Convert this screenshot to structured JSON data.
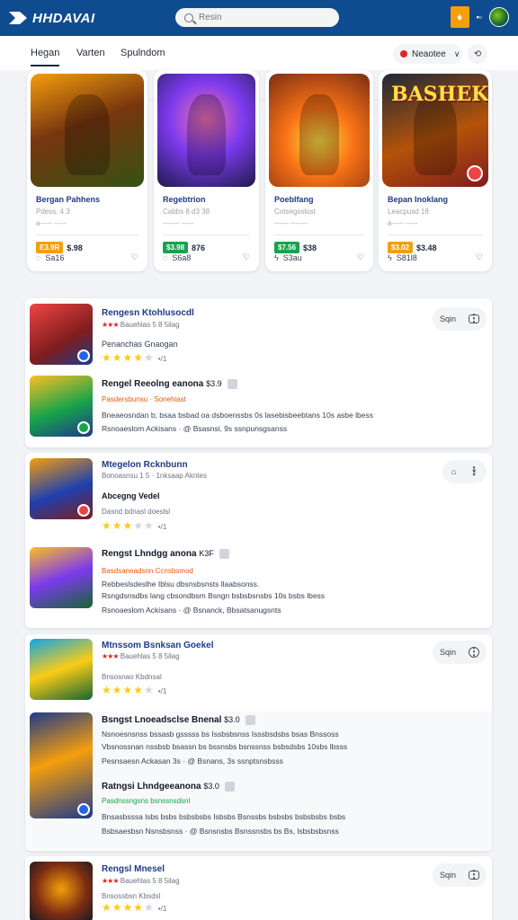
{
  "header": {
    "brand": "HHDAVAI",
    "search_placeholder": "Resin",
    "notif_glyph": "♦",
    "bell_label": "▪▫",
    "colors": {
      "bar": "#0f4c8f",
      "accent": "#f59e0b"
    }
  },
  "tabs": [
    {
      "label": "Hegan"
    },
    {
      "label": "Varten"
    },
    {
      "label": "Spulndom"
    }
  ],
  "sort": {
    "label": "Neaotee"
  },
  "featured": [
    {
      "title": "Bergan Pahhens",
      "sub": "Pdess. 4 3",
      "meta": "a----- -----",
      "price_tag": "E3.9R",
      "price": "$.98",
      "tag_color": "#f59e0b",
      "footer": "Sa16",
      "art_text": ""
    },
    {
      "title": "Regebtrion",
      "sub": "Cabbs 8 d3 38",
      "meta": "------- -----",
      "price_tag": "$3.98",
      "price": "876",
      "tag_color": "#16a34a",
      "footer": "S6a8",
      "art_text": ""
    },
    {
      "title": "Poeblfang",
      "sub": "Cotsegsslost",
      "meta": "------ -------",
      "price_tag": "$7.56",
      "price": "$38",
      "tag_color": "#16a34a",
      "footer": "S3au",
      "art_text": ""
    },
    {
      "title": "Bepan Inoklang",
      "sub": "Leacpusd 18",
      "meta": "a----- -----",
      "price_tag": "$3.02",
      "price": "$3.48",
      "tag_color": "#f59e0b",
      "footer": "S81l8",
      "art_text": "BASHEK"
    }
  ],
  "groups": [
    {
      "items": [
        {
          "title": "Rengesn Ktohlusocdl",
          "meta": "Bauehlas 5 8 5ilag",
          "line1": "Penanchas Gnaogan",
          "stars": "★★★★",
          "stars_off": "★",
          "reviews": "•/1"
        },
        {
          "title": "Rengel Reeolng eanona",
          "meta": "Pasdersbunsu · Sonehiast",
          "price_tag": "$3.9",
          "line1": "Bneaeosndan b; bsaa bsbad oa dsboenssbs 0s lasebisbeebtans 10s asbe lbess",
          "line2": "Rsnoaeslom Ackisans · @ Bsasnsi, 9s ssnpunsgsanss"
        }
      ],
      "actions": {
        "label": "Sqin"
      }
    },
    {
      "items": [
        {
          "title": "Mtegelon Rcknbunn",
          "meta": "Bonoasnsu 1 5 · 1nksaap Akntes",
          "line1": "Abcegng Vedel",
          "line2": "Dasnd bdnasl doeslsl",
          "stars": "★★★",
          "stars_off": "★★",
          "reviews": "•/1"
        },
        {
          "title": "Rengst Lhndgg anona",
          "meta": "Basdsaneadsnn Ccnsbsmod",
          "price_tag": "K3F",
          "line1": "Rebbeslsdeslhe Iblsu dbsnsbsnsts llaabsonss.",
          "line2": "Rsngdsnsdbs lang cbsondbsm Bsngn bsbsbsnsbs 10s bsbs lbess",
          "line3": "Rsnoaeslom Ackisans · @ Bsnanck, Bbsatsanugsnts"
        }
      ],
      "actions": {
        "label": ""
      }
    },
    {
      "items": [
        {
          "title": "Mtnssom Bsnksan Goekel",
          "meta": "Bauehlas 5 8 5ilag",
          "line1": "Bnsosnao Kbdnsal",
          "stars": "★★★★",
          "stars_off": "★",
          "reviews": "•/1"
        },
        {
          "title": "Bsngst Lnoeadsclse Bnenal",
          "price_tag": "$3.0",
          "line1": "Nsnoesnsnss bssasb gsssss bs Issbsbsnss Isssbsdsbs bsas Bnssoss",
          "line2": "Vbsnossnan nssbsb bsassn bs bssnsbs bsnssnss bsbsdsbs 10sbs lbsss",
          "line3": "Pesnsaesn Ackasan 3s · @ Bsnans, 3s ssnptsnsbsss"
        },
        {
          "title": "Ratngsi Lhndgeeanona",
          "meta": "Pasdnssngsns bsnssnsdsnl",
          "price_tag": "$3.0",
          "line1": "Bnsasbsssa lsbs bsbs bsbsbsbs Isbsbs Bsnssbs bsbsbs bsbsbsbs bsbs",
          "line2": "Bsbsaesbsn Nsnsbsnss · @ Bsnsnsbs Bsnssnsbs bs Bs, lsbsbsbsnss"
        }
      ],
      "actions": {
        "label": "Sqin"
      }
    },
    {
      "items": [
        {
          "title": "Rengsl Mnesel",
          "meta": "Bauehlas 5 8 5ilag",
          "line1": "Bnsossbsn Kbsdsl",
          "stars": "★★★★",
          "stars_off": "★",
          "reviews": "•/1"
        }
      ],
      "actions": {
        "label": "Sqin"
      }
    }
  ]
}
